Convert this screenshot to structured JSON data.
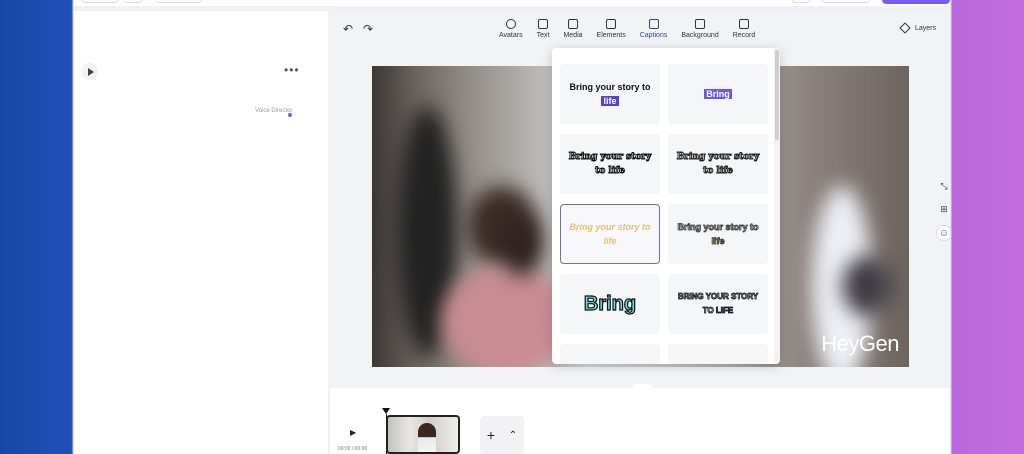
{
  "toolbar": {
    "undo_label": "↶",
    "redo_label": "↷",
    "tools": [
      {
        "label": "Avatars",
        "icon": "avatar-icon"
      },
      {
        "label": "Text",
        "icon": "text-icon"
      },
      {
        "label": "Media",
        "icon": "media-icon"
      },
      {
        "label": "Elements",
        "icon": "elements-icon"
      },
      {
        "label": "Captions",
        "icon": "captions-icon"
      },
      {
        "label": "Background",
        "icon": "background-icon"
      },
      {
        "label": "Record",
        "icon": "record-icon"
      }
    ],
    "layers_label": "Layers"
  },
  "left_panel": {
    "voice_director_label": "Voice Director",
    "more_label": "•••"
  },
  "canvas": {
    "watermark": "HeyGen"
  },
  "captions": {
    "styles": [
      {
        "text_a": "Bring your story to ",
        "text_b": "life"
      },
      {
        "text_a": "",
        "text_b": "Bring"
      },
      {
        "text_a": "Bring your story to life",
        "text_b": ""
      },
      {
        "text_a": "Bring your story to ",
        "text_b": "life"
      },
      {
        "text_a": "Bring your story to life",
        "text_b": ""
      },
      {
        "text_a": "Bring your story to ",
        "text_b": "life"
      },
      {
        "text_a": "Bring",
        "text_b": ""
      },
      {
        "text_a": "BRING YOUR STORY TO ",
        "text_b": "LIFE"
      }
    ]
  },
  "timeline": {
    "time_label": "00:00 / 00:00",
    "play_label": "▶",
    "add_label": "+",
    "collapse_label": "⌃",
    "expand_label": "⌄"
  }
}
